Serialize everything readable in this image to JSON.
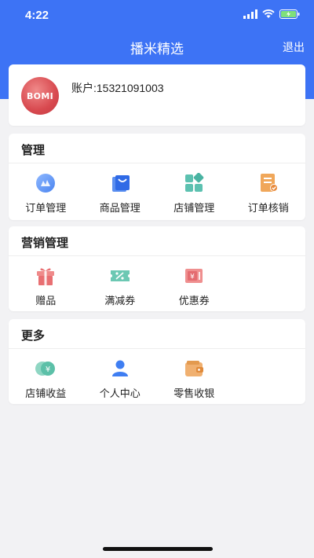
{
  "status": {
    "time": "4:22"
  },
  "nav": {
    "title": "播米精选",
    "logout": "退出"
  },
  "account": {
    "avatar_text": "BOMI",
    "account_line": "账户:15321091003"
  },
  "sections": [
    {
      "title": "管理",
      "items": [
        {
          "label": "订单管理",
          "icon": "order-icon"
        },
        {
          "label": "商品管理",
          "icon": "goods-bag-icon"
        },
        {
          "label": "店铺管理",
          "icon": "store-grid-icon"
        },
        {
          "label": "订单核销",
          "icon": "order-verify-icon"
        }
      ]
    },
    {
      "title": "营销管理",
      "items": [
        {
          "label": "赠品",
          "icon": "gift-icon"
        },
        {
          "label": "满减券",
          "icon": "discount-ticket-icon"
        },
        {
          "label": "优惠券",
          "icon": "coupon-icon"
        }
      ]
    },
    {
      "title": "更多",
      "items": [
        {
          "label": "店铺收益",
          "icon": "coins-icon"
        },
        {
          "label": "个人中心",
          "icon": "person-icon"
        },
        {
          "label": "零售收银",
          "icon": "wallet-icon"
        }
      ]
    }
  ],
  "colors": {
    "header": "#3d73f5",
    "background": "#f2f2f4"
  }
}
